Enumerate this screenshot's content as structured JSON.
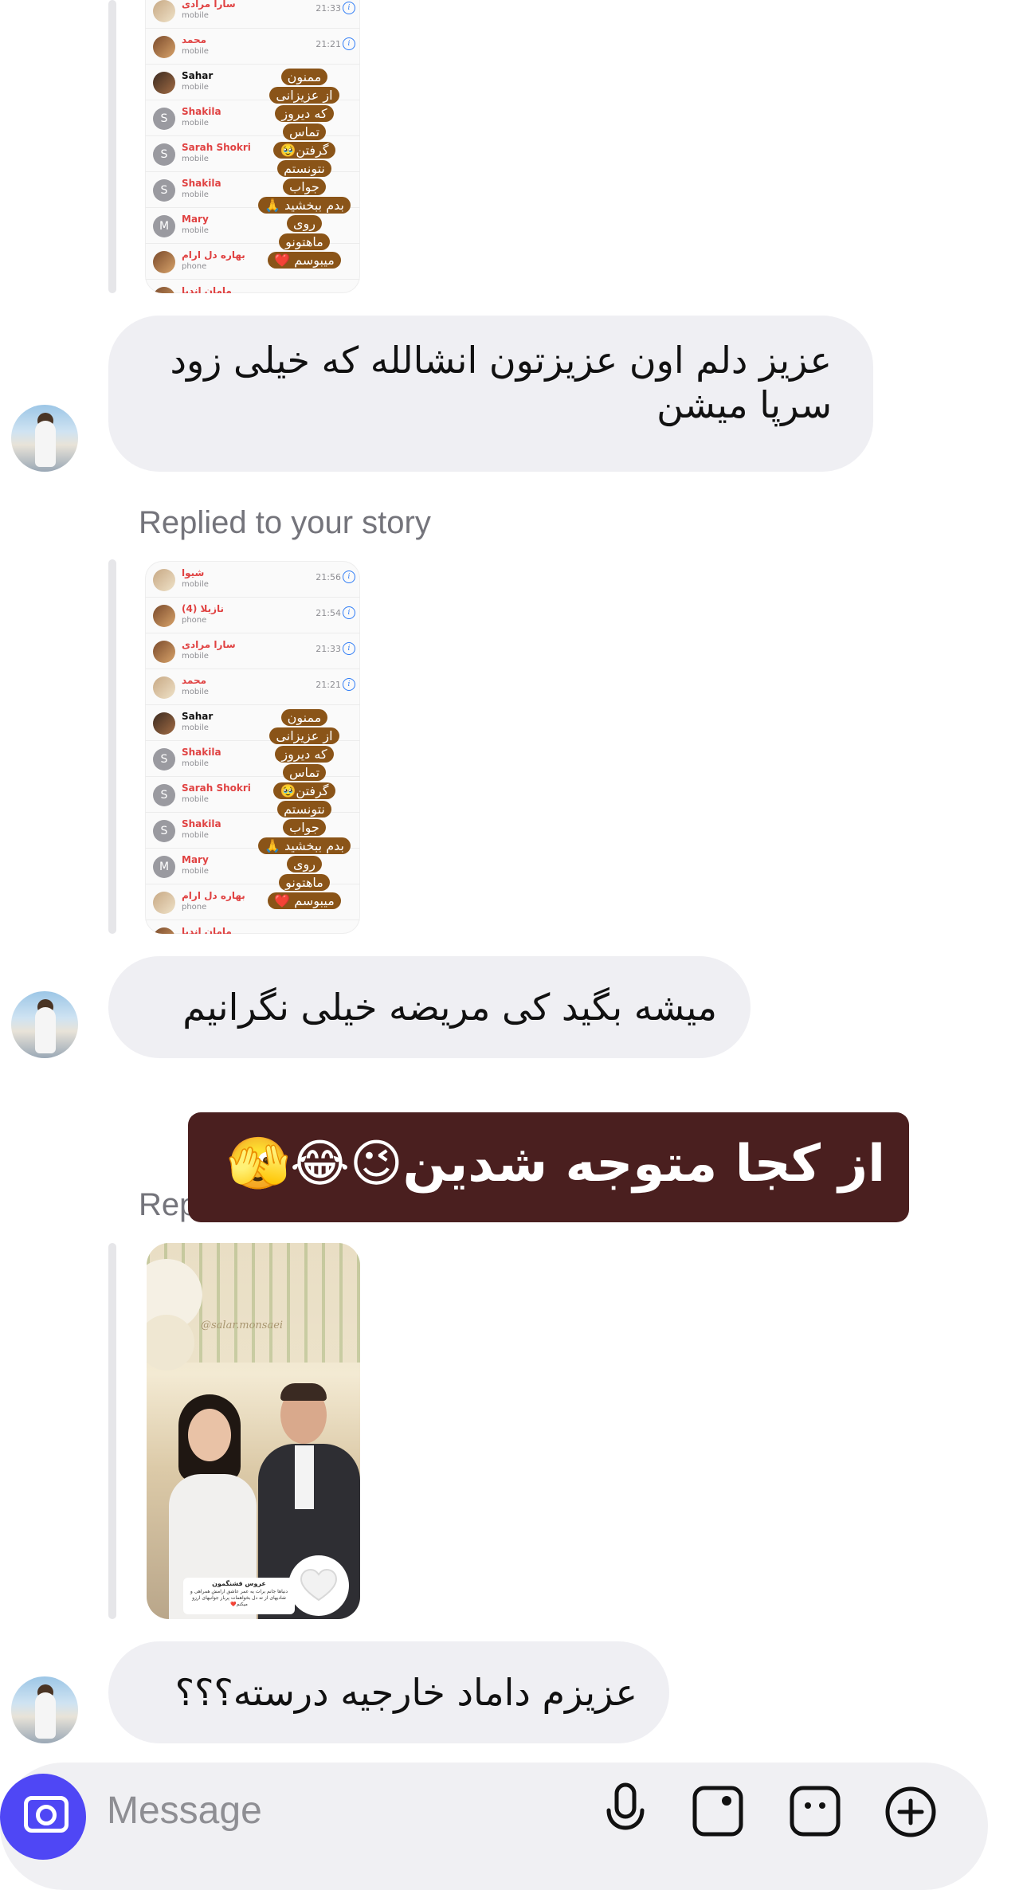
{
  "top_story": {
    "rows": [
      {
        "name": "سارا مرادی",
        "type": "mobile",
        "time": "21:33",
        "avatar": "",
        "dark": false
      },
      {
        "name": "محمد",
        "type": "mobile",
        "time": "21:21",
        "avatar": "",
        "dark": false
      },
      {
        "name": "Sahar",
        "type": "mobile",
        "time": "",
        "avatar": "",
        "dark": true
      },
      {
        "name": "Shakila",
        "type": "mobile",
        "time": "",
        "avatar": "S",
        "dark": false
      },
      {
        "name": "Sarah Shokri",
        "type": "mobile",
        "time": "",
        "avatar": "S",
        "dark": false
      },
      {
        "name": "Shakila",
        "type": "mobile",
        "time": "",
        "avatar": "S",
        "dark": false
      },
      {
        "name": "Mary",
        "type": "mobile",
        "time": "",
        "avatar": "M",
        "dark": false
      },
      {
        "name": "بهاره دل ارام",
        "type": "phone",
        "time": "",
        "avatar": "",
        "dark": false
      },
      {
        "name": "مامان انديا",
        "type": "",
        "time": "",
        "avatar": "",
        "dark": false
      }
    ]
  },
  "sticker_lines": [
    "ممنون",
    "از عزیزانی",
    "که دیروز",
    "تماس",
    "گرفتن🥹",
    "نتونستم",
    "جواب",
    "بدم ببخشید 🙏",
    "روی",
    "ماهتونو",
    "میبوسم ❤️"
  ],
  "messages": [
    {
      "text": "عزیز دلم اون عزیزتون انشالله که خیلی زود سرپا میشن"
    },
    {
      "text": "میشه بگید کی مریضه خیلی نگرانیم"
    },
    {
      "text": "عزیزم داماد خارجیه درسته؟؟؟"
    }
  ],
  "replied_label": "Replied to your story",
  "replied_label_partial": "Rep",
  "second_story": {
    "rows": [
      {
        "name": "شیوا",
        "type": "mobile",
        "time": "21:56",
        "avatar": "",
        "dark": false
      },
      {
        "name": "نازیلا (4)",
        "type": "phone",
        "time": "21:54",
        "avatar": "",
        "dark": false
      },
      {
        "name": "سارا مرادی",
        "type": "mobile",
        "time": "21:33",
        "avatar": "",
        "dark": false
      },
      {
        "name": "محمد",
        "type": "mobile",
        "time": "21:21",
        "avatar": "",
        "dark": false
      },
      {
        "name": "Sahar",
        "type": "mobile",
        "time": "",
        "avatar": "",
        "dark": true
      },
      {
        "name": "Shakila",
        "type": "mobile",
        "time": "",
        "avatar": "S",
        "dark": false
      },
      {
        "name": "Sarah Shokri",
        "type": "mobile",
        "time": "",
        "avatar": "S",
        "dark": false
      },
      {
        "name": "Shakila",
        "type": "mobile",
        "time": "",
        "avatar": "S",
        "dark": false
      },
      {
        "name": "Mary",
        "type": "mobile",
        "time": "",
        "avatar": "M",
        "dark": false
      },
      {
        "name": "بهاره دل ارام",
        "type": "phone",
        "time": "",
        "avatar": "",
        "dark": false
      },
      {
        "name": "مامان انديا",
        "type": "",
        "time": "",
        "avatar": "",
        "dark": false
      }
    ]
  },
  "overlay_caption": "از کجا متوجه شدین😉😂🫣",
  "wedding_story": {
    "watermark": "@salar.monsaei",
    "banner_title": "عروس قشنگمون",
    "banner_text": "دنیاها جانم برات یه عمر عاشق ارامش همراهی و شادیهای از ته دل بخواهمات پرباز جوانیهای ارزو میکنم❤️"
  },
  "composer": {
    "placeholder": "Message"
  },
  "icons": {
    "camera": "camera-icon",
    "mic": "microphone-icon",
    "gallery": "gallery-icon",
    "sticker": "sticker-icon",
    "add": "plus-circle-icon",
    "heart": "heart-icon"
  },
  "colors": {
    "bubble": "#efeff3",
    "accent": "#4f47f5",
    "overlay": "#4a1f1f",
    "sticker": "#8a5418"
  }
}
